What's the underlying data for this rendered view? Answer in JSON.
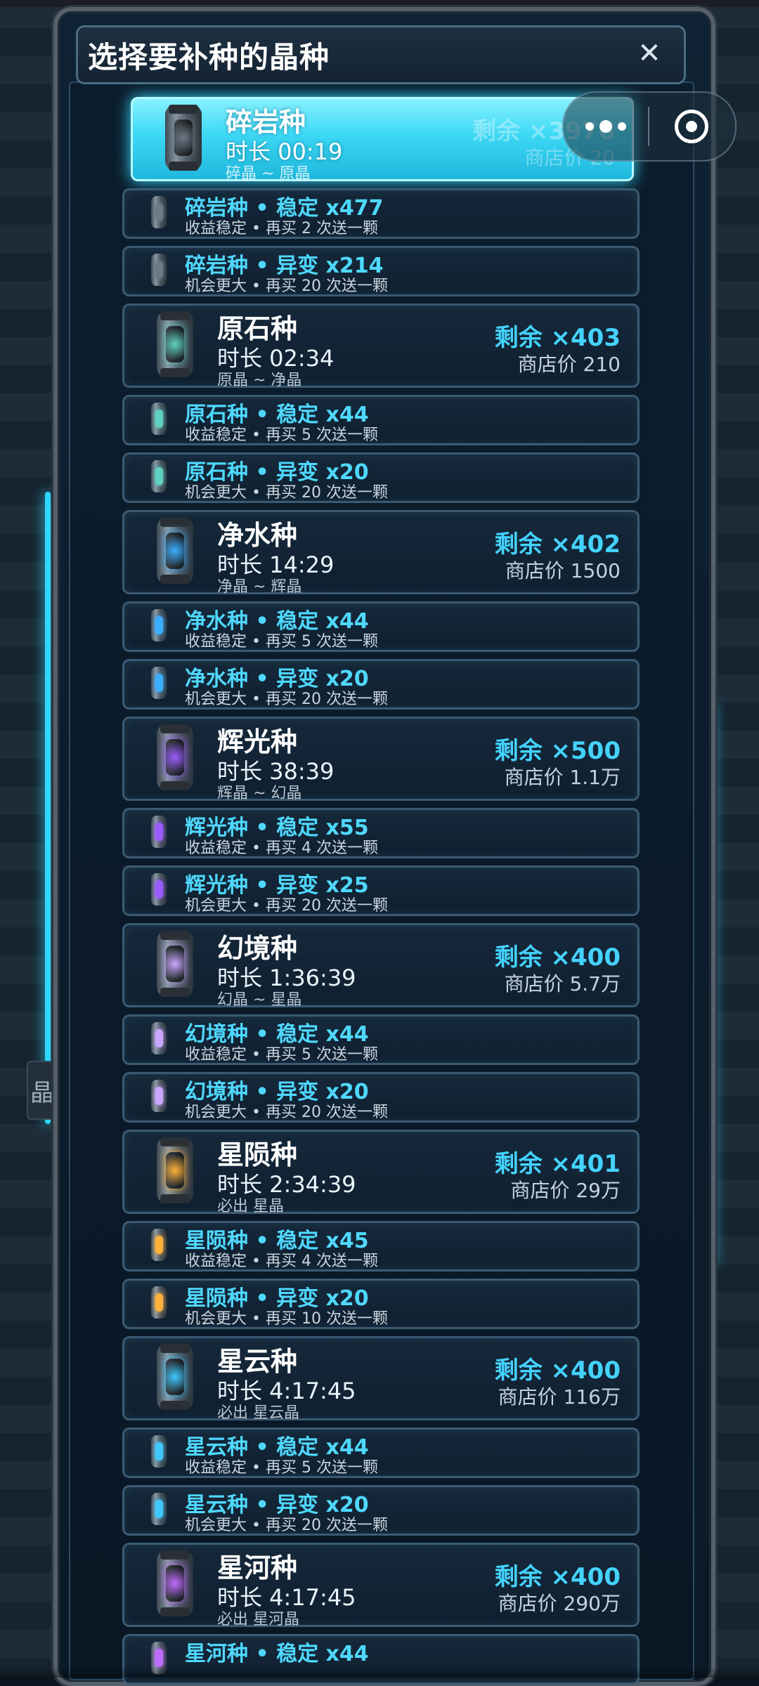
{
  "dialog": {
    "title": "选择要补种的晶种",
    "close_icon": "close-icon"
  },
  "capsule": {
    "more_icon": "more-dots-icon",
    "exit_icon": "target-ring-icon"
  },
  "side_tab_label": "晶",
  "colors": {
    "accent": "#44d2ff",
    "selected": "#3cd8f5"
  },
  "seeds": [
    {
      "name": "碎岩种",
      "time": "时长 00:19",
      "yield": "碎晶 ~ 原晶",
      "remain": "剩余 ×3976",
      "price": "商店价 20",
      "selected": true,
      "color": "#6c7a86",
      "variants": [
        {
          "title": "碎岩种 • 稳定 x477",
          "desc": "收益稳定 • 再买 2 次送一颗"
        },
        {
          "title": "碎岩种 • 异变 x214",
          "desc": "机会更大 • 再买 20 次送一颗"
        }
      ]
    },
    {
      "name": "原石种",
      "time": "时长 02:34",
      "yield": "原晶 ~ 净晶",
      "remain": "剩余 ×403",
      "price": "商店价 210",
      "selected": false,
      "color": "#5fd1c2",
      "variants": [
        {
          "title": "原石种 • 稳定 x44",
          "desc": "收益稳定 • 再买 5 次送一颗"
        },
        {
          "title": "原石种 • 异变 x20",
          "desc": "机会更大 • 再买 20 次送一颗"
        }
      ]
    },
    {
      "name": "净水种",
      "time": "时长 14:29",
      "yield": "净晶 ~ 辉晶",
      "remain": "剩余 ×402",
      "price": "商店价 1500",
      "selected": false,
      "color": "#3aaeff",
      "variants": [
        {
          "title": "净水种 • 稳定 x44",
          "desc": "收益稳定 • 再买 5 次送一颗"
        },
        {
          "title": "净水种 • 异变 x20",
          "desc": "机会更大 • 再买 20 次送一颗"
        }
      ]
    },
    {
      "name": "辉光种",
      "time": "时长 38:39",
      "yield": "辉晶 ~ 幻晶",
      "remain": "剩余 ×500",
      "price": "商店价 1.1万",
      "selected": false,
      "color": "#9a5cff",
      "variants": [
        {
          "title": "辉光种 • 稳定 x55",
          "desc": "收益稳定 • 再买 4 次送一颗"
        },
        {
          "title": "辉光种 • 异变 x25",
          "desc": "机会更大 • 再买 20 次送一颗"
        }
      ]
    },
    {
      "name": "幻境种",
      "time": "时长 1:36:39",
      "yield": "幻晶 ~ 星晶",
      "remain": "剩余 ×400",
      "price": "商店价 5.7万",
      "selected": false,
      "color": "#c9a7ff",
      "variants": [
        {
          "title": "幻境种 • 稳定 x44",
          "desc": "收益稳定 • 再买 5 次送一颗"
        },
        {
          "title": "幻境种 • 异变 x20",
          "desc": "机会更大 • 再买 20 次送一颗"
        }
      ]
    },
    {
      "name": "星陨种",
      "time": "时长 2:34:39",
      "yield": "必出 星晶",
      "remain": "剩余 ×401",
      "price": "商店价 29万",
      "selected": false,
      "color": "#ffb23a",
      "variants": [
        {
          "title": "星陨种 • 稳定 x45",
          "desc": "收益稳定 • 再买 4 次送一颗"
        },
        {
          "title": "星陨种 • 异变 x20",
          "desc": "机会更大 • 再买 10 次送一颗"
        }
      ]
    },
    {
      "name": "星云种",
      "time": "时长 4:17:45",
      "yield": "必出 星云晶",
      "remain": "剩余 ×400",
      "price": "商店价 116万",
      "selected": false,
      "color": "#3fc8ff",
      "variants": [
        {
          "title": "星云种 • 稳定 x44",
          "desc": "收益稳定 • 再买 5 次送一颗"
        },
        {
          "title": "星云种 • 异变 x20",
          "desc": "机会更大 • 再买 20 次送一颗"
        }
      ]
    },
    {
      "name": "星河种",
      "time": "时长 4:17:45",
      "yield": "必出 星河晶",
      "remain": "剩余 ×400",
      "price": "商店价 290万",
      "selected": false,
      "color": "#c06bff",
      "variants": [
        {
          "title": "星河种 • 稳定 x44",
          "desc": ""
        }
      ]
    }
  ]
}
